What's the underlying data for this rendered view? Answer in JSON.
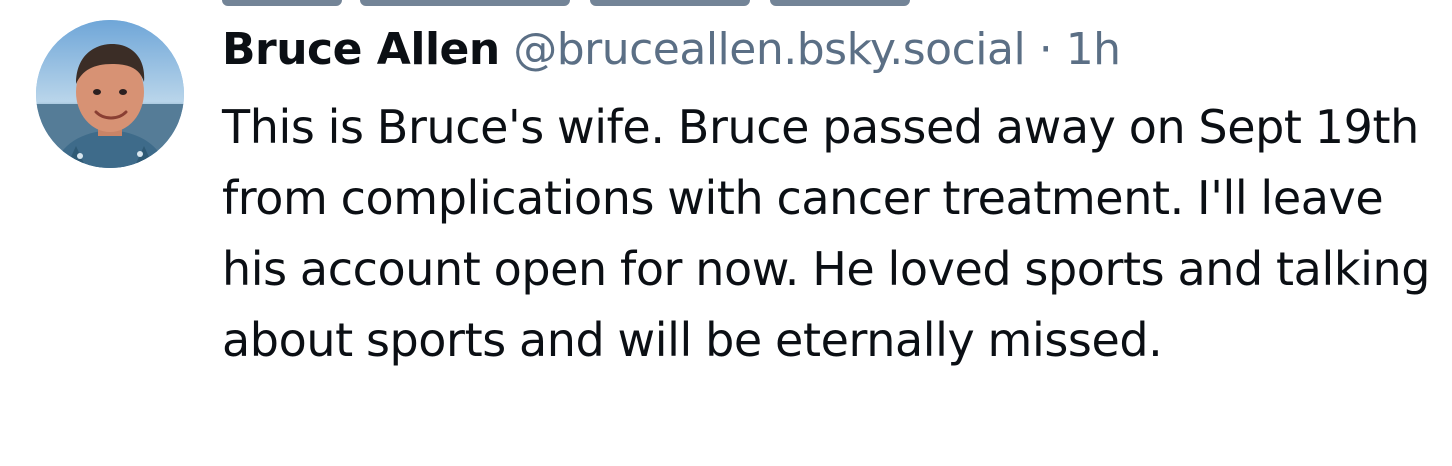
{
  "post": {
    "author": {
      "display_name": "Bruce Allen",
      "handle": "@bruceallen.bsky.social"
    },
    "separator": "·",
    "timestamp": "1h",
    "text": "This is Bruce's wife. Bruce passed away on Sept 19th from complications with cancer treatment. I'll leave his account open for now. He loved sports and talking about sports and will be eternally missed."
  },
  "colors": {
    "primary_text": "#0b0f14",
    "secondary_text": "#5b6f85",
    "background": "#ffffff"
  },
  "icons": {
    "avatar": "profile-photo"
  }
}
